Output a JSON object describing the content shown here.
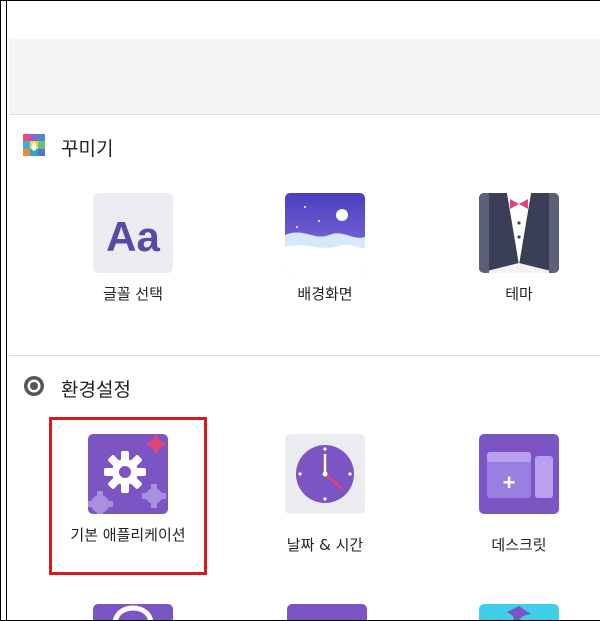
{
  "sections": [
    {
      "title": "꾸미기",
      "icon": "palette-grid-icon",
      "items": [
        {
          "label": "글꼴 선택",
          "icon": "font-Aa-icon"
        },
        {
          "label": "배경화면",
          "icon": "wallpaper-icon"
        },
        {
          "label": "테마",
          "icon": "tuxedo-theme-icon"
        }
      ]
    },
    {
      "title": "환경설정",
      "icon": "settings-circle-icon",
      "items": [
        {
          "label": "기본 애플리케이션",
          "icon": "gear-app-icon"
        },
        {
          "label": "날짜 & 시간",
          "icon": "clock-icon"
        },
        {
          "label": "데스크릿",
          "icon": "desklet-icon"
        }
      ]
    }
  ],
  "colors": {
    "accent_purple": "#7b55c4",
    "highlight_red": "#d71920"
  }
}
